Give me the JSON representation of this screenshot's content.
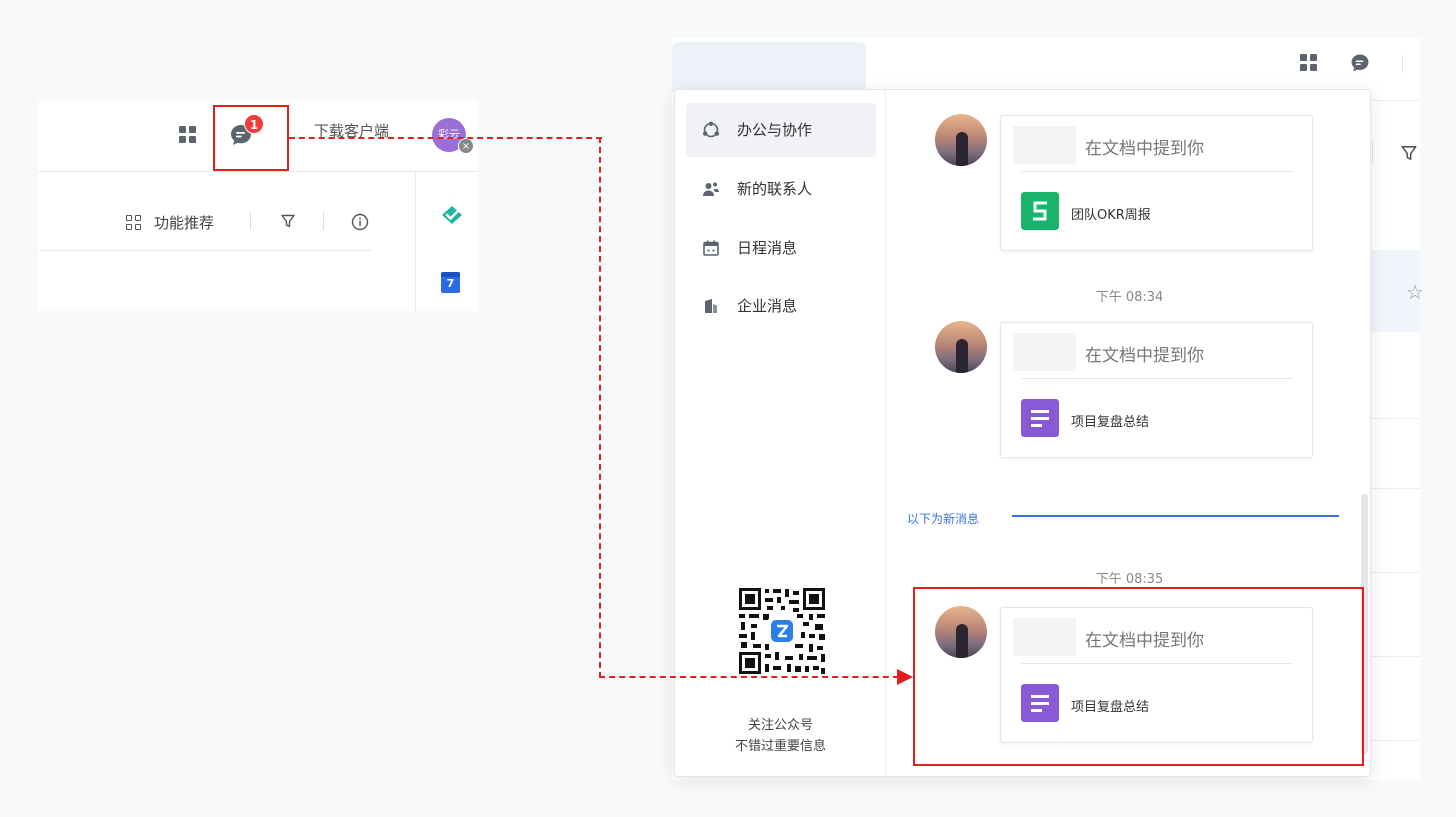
{
  "left_header": {
    "notification_count": "1",
    "download_label": "下载客户端",
    "avatar_text": "彩云",
    "feature_recommend": "功能推荐",
    "calendar_day": "7"
  },
  "popup": {
    "nav": [
      {
        "label": "办公与协作",
        "icon": "office-collab-icon",
        "active": true
      },
      {
        "label": "新的联系人",
        "icon": "contacts-icon",
        "active": false
      },
      {
        "label": "日程消息",
        "icon": "calendar-icon",
        "active": false
      },
      {
        "label": "企业消息",
        "icon": "building-icon",
        "active": false
      }
    ],
    "qr_caption_line1": "关注公众号",
    "qr_caption_line2": "不错过重要信息",
    "messages": [
      {
        "title": "在文档中提到你",
        "doc": "团队OKR周报",
        "doc_icon": "sheet-icon",
        "doc_color": "#19b46c"
      },
      {
        "time": "下午 08:34",
        "title": "在文档中提到你",
        "doc": "项目复盘总结",
        "doc_icon": "doc-icon",
        "doc_color": "#8a5ad6"
      },
      {
        "time": "下午 08:35",
        "title": "在文档中提到你",
        "doc": "项目复盘总结",
        "doc_icon": "doc-icon",
        "doc_color": "#8a5ad6"
      }
    ],
    "new_divider": "以下为新消息"
  },
  "colors": {
    "highlight": "#e41e1e",
    "accent_blue": "#3a72e6",
    "badge_red": "#f53b3b"
  }
}
